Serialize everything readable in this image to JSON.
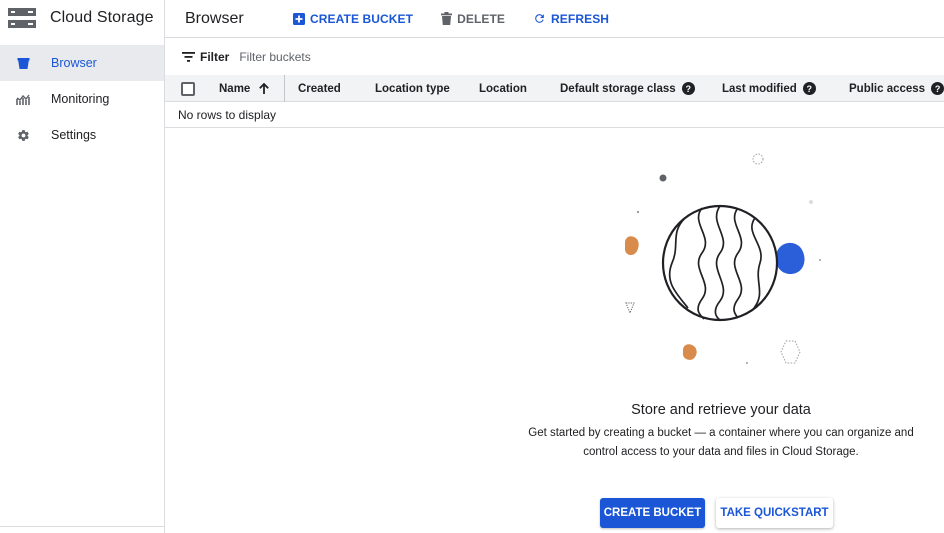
{
  "app": {
    "title": "Cloud Storage",
    "logo_icon": "storage-icon"
  },
  "sidebar": {
    "items": [
      {
        "label": "Browser",
        "icon": "bucket-icon",
        "active": true
      },
      {
        "label": "Monitoring",
        "icon": "chart-icon",
        "active": false
      },
      {
        "label": "Settings",
        "icon": "gear-icon",
        "active": false
      }
    ]
  },
  "header": {
    "title": "Browser",
    "actions": {
      "create_bucket": "CREATE BUCKET",
      "delete": "DELETE",
      "refresh": "REFRESH"
    }
  },
  "filter": {
    "label": "Filter",
    "placeholder": "Filter buckets"
  },
  "table": {
    "columns": {
      "name": "Name",
      "created": "Created",
      "location_type": "Location type",
      "location": "Location",
      "storage_class": "Default storage class",
      "last_modified": "Last modified",
      "public_access": "Public access"
    },
    "help_glyph": "?",
    "empty_message": "No rows to display"
  },
  "empty_state": {
    "title": "Store and retrieve your data",
    "description": "Get started by creating a bucket — a container where you can organize and control access to your data and files in Cloud Storage.",
    "primary_button": "CREATE BUCKET",
    "secondary_button": "TAKE QUICKSTART"
  },
  "colors": {
    "accent": "#1a56d6",
    "text": "#202124",
    "muted": "#5f6368",
    "divider": "#dadce0",
    "header_bg": "#f1f3f4",
    "illustration_orange": "#d98b4c",
    "illustration_blue": "#2b5fd9"
  }
}
